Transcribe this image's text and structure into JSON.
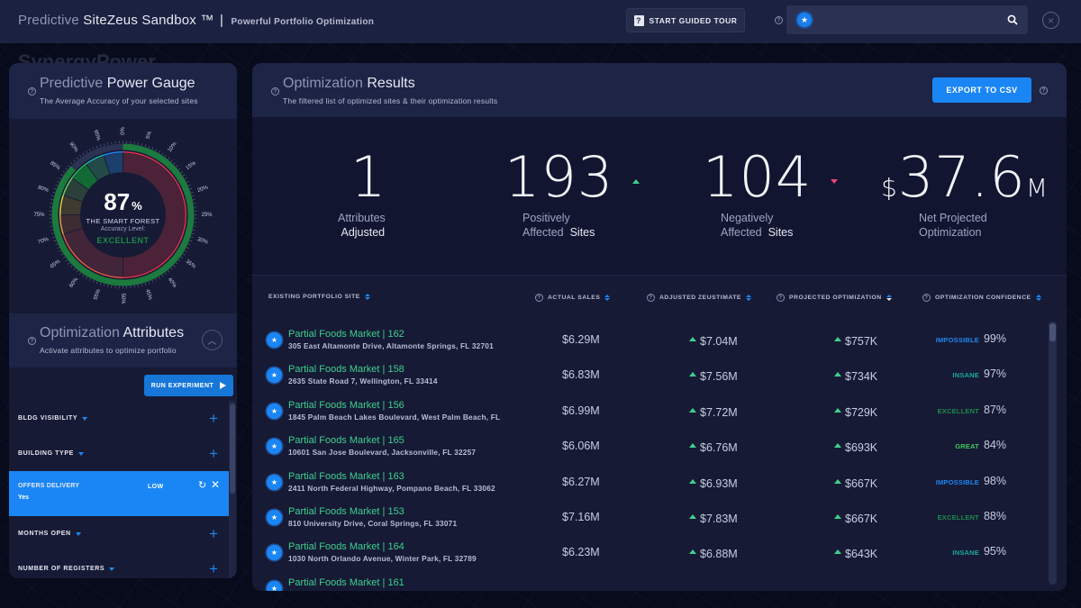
{
  "header": {
    "title_light": "Predictive",
    "title_main": "SiteZeus Sandbox ™",
    "separator": "|",
    "subtitle": "Powerful Portfolio Optimization",
    "tour_button": "START GUIDED TOUR",
    "tour_icon": "?",
    "search_value": ""
  },
  "background": {
    "map_label": "SynergyPower"
  },
  "gauge": {
    "title_light": "Predictive",
    "title_main": "Power Gauge",
    "subtitle": "The Average Accuracy of your selected sites",
    "percent": "87",
    "percent_symbol": "%",
    "site_name": "THE SMART FOREST",
    "accuracy_label": "Accuracy Level:",
    "level": "EXCELLENT",
    "value_fraction": 0.87,
    "tick_labels": [
      "0%",
      "5%",
      "10%",
      "15%",
      "20%",
      "25%",
      "30%",
      "35%",
      "40%",
      "45%",
      "50%",
      "55%",
      "60%",
      "65%",
      "70%",
      "75%",
      "80%",
      "85%",
      "90%",
      "95%"
    ]
  },
  "attributes": {
    "title_light": "Optimization",
    "title_main": "Attributes",
    "subtitle": "Activate attributes to optimize portfolio",
    "run_button": "RUN EXPERIMENT",
    "items": [
      {
        "label": "BLDG VISIBILITY"
      },
      {
        "label": "BUILDING TYPE"
      },
      {
        "label": "OFFERS DELIVERY",
        "value": "Yes",
        "level": "LOW",
        "active": true
      },
      {
        "label": "MONTHS OPEN"
      },
      {
        "label": "NUMBER OF REGISTERS"
      }
    ]
  },
  "results": {
    "title_light": "Optimization",
    "title_main": "Results",
    "subtitle": "The filtered list of optimized sites & their optimization results",
    "export_button": "EXPORT TO CSV",
    "stats": [
      {
        "value": "1",
        "label_light": "Attributes",
        "label_bold": "Adjusted"
      },
      {
        "value": "193",
        "label_light1": "Positively",
        "label_light2": "Affected",
        "label_bold": "Sites",
        "trend": "up"
      },
      {
        "value": "104",
        "label_light1": "Negatively",
        "label_light2": "Affected",
        "label_bold": "Sites",
        "trend": "down"
      },
      {
        "prefix": "$",
        "value": "37.6",
        "suffix": "M",
        "label_line1": "Net Projected",
        "label_line2": "Optimization"
      }
    ],
    "columns": [
      "EXISTING PORTFOLIO SITE",
      "ACTUAL SALES",
      "ADJUSTED ZEUSTIMATE",
      "PROJECTED OPTIMIZATION",
      "OPTIMIZATION CONFIDENCE"
    ],
    "rows": [
      {
        "name": "Partial Foods Market | 162",
        "address": "305 East Altamonte Drive, Altamonte Springs, FL 32701",
        "actual": "$6.29M",
        "zeustimate": "$7.04M",
        "optimization": "$757K",
        "confidence_label": "IMPOSSIBLE",
        "confidence": "99%"
      },
      {
        "name": "Partial Foods Market | 158",
        "address": "2635 State Road 7, Wellington, FL 33414",
        "actual": "$6.83M",
        "zeustimate": "$7.56M",
        "optimization": "$734K",
        "confidence_label": "INSANE",
        "confidence": "97%"
      },
      {
        "name": "Partial Foods Market | 156",
        "address": "1845 Palm Beach Lakes Boulevard, West Palm Beach, FL",
        "actual": "$6.99M",
        "zeustimate": "$7.72M",
        "optimization": "$729K",
        "confidence_label": "EXCELLENT",
        "confidence": "87%"
      },
      {
        "name": "Partial Foods Market | 165",
        "address": "10601 San Jose Boulevard, Jacksonville, FL 32257",
        "actual": "$6.06M",
        "zeustimate": "$6.76M",
        "optimization": "$693K",
        "confidence_label": "GREAT",
        "confidence": "84%"
      },
      {
        "name": "Partial Foods Market | 163",
        "address": "2411 North Federal Highway, Pompano Beach, FL 33062",
        "actual": "$6.27M",
        "zeustimate": "$6.93M",
        "optimization": "$667K",
        "confidence_label": "IMPOSSIBLE",
        "confidence": "98%"
      },
      {
        "name": "Partial Foods Market | 153",
        "address": "810 University Drive, Coral Springs, FL 33071",
        "actual": "$7.16M",
        "zeustimate": "$7.83M",
        "optimization": "$667K",
        "confidence_label": "EXCELLENT",
        "confidence": "88%"
      },
      {
        "name": "Partial Foods Market | 164",
        "address": "1030 North Orlando Avenue, Winter Park, FL 32789",
        "actual": "$6.23M",
        "zeustimate": "$6.88M",
        "optimization": "$643K",
        "confidence_label": "INSANE",
        "confidence": "95%"
      },
      {
        "name": "Partial Foods Market | 161",
        "address": "",
        "actual": "",
        "zeustimate": "",
        "optimization": "",
        "confidence_label": "",
        "confidence": ""
      }
    ]
  },
  "colors": {
    "accent": "#1a86f5",
    "positive": "#3ed08c",
    "negative": "#e8437d",
    "site_name": "#3ecf8e",
    "IMPOSSIBLE": "#1f86f0",
    "INSANE": "#1aa99a",
    "EXCELLENT": "#1e8a48",
    "GREAT": "#3ec95a"
  }
}
